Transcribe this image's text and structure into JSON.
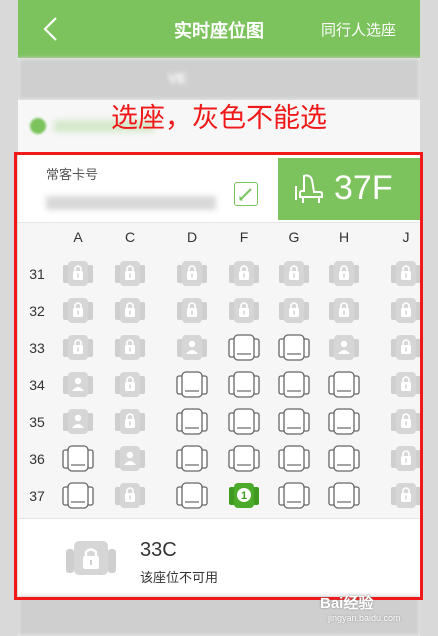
{
  "header": {
    "title": "实时座位图",
    "right_action": "同行人选座"
  },
  "flight_bar": {
    "text": "VE"
  },
  "annotation": {
    "text": "选座，灰色不能选"
  },
  "passenger": {
    "ff_label": "常客卡号",
    "selected_seat": "37F"
  },
  "seat_map": {
    "columns": [
      "A",
      "C",
      "D",
      "F",
      "G",
      "H",
      "J"
    ],
    "rows": [
      {
        "number": "31",
        "seats": [
          "locked",
          "locked",
          "locked",
          "locked",
          "locked",
          "locked",
          "locked"
        ]
      },
      {
        "number": "32",
        "seats": [
          "locked",
          "locked",
          "locked",
          "locked",
          "locked",
          "locked",
          "locked"
        ]
      },
      {
        "number": "33",
        "seats": [
          "locked",
          "locked",
          "occupied",
          "available",
          "available",
          "occupied",
          "locked"
        ]
      },
      {
        "number": "34",
        "seats": [
          "occupied",
          "locked",
          "available",
          "available",
          "available",
          "available",
          "locked"
        ]
      },
      {
        "number": "35",
        "seats": [
          "occupied",
          "locked",
          "available",
          "available",
          "available",
          "available",
          "locked"
        ]
      },
      {
        "number": "36",
        "seats": [
          "available",
          "occupied",
          "available",
          "available",
          "available",
          "available",
          "locked"
        ]
      },
      {
        "number": "37",
        "seats": [
          "available",
          "locked",
          "available",
          "selected",
          "available",
          "available",
          "locked"
        ]
      }
    ],
    "selected_badge": "1"
  },
  "seat_info": {
    "code": "33C",
    "status": "该座位不可用"
  },
  "watermark": {
    "brand": "Bai经验",
    "sub": "jingyan.baidu.com"
  },
  "colors": {
    "brand_green": "#7cc35d",
    "annotation_red": "#f01818",
    "locked_gray": "#d0d0d0",
    "available_outline": "#666666"
  }
}
